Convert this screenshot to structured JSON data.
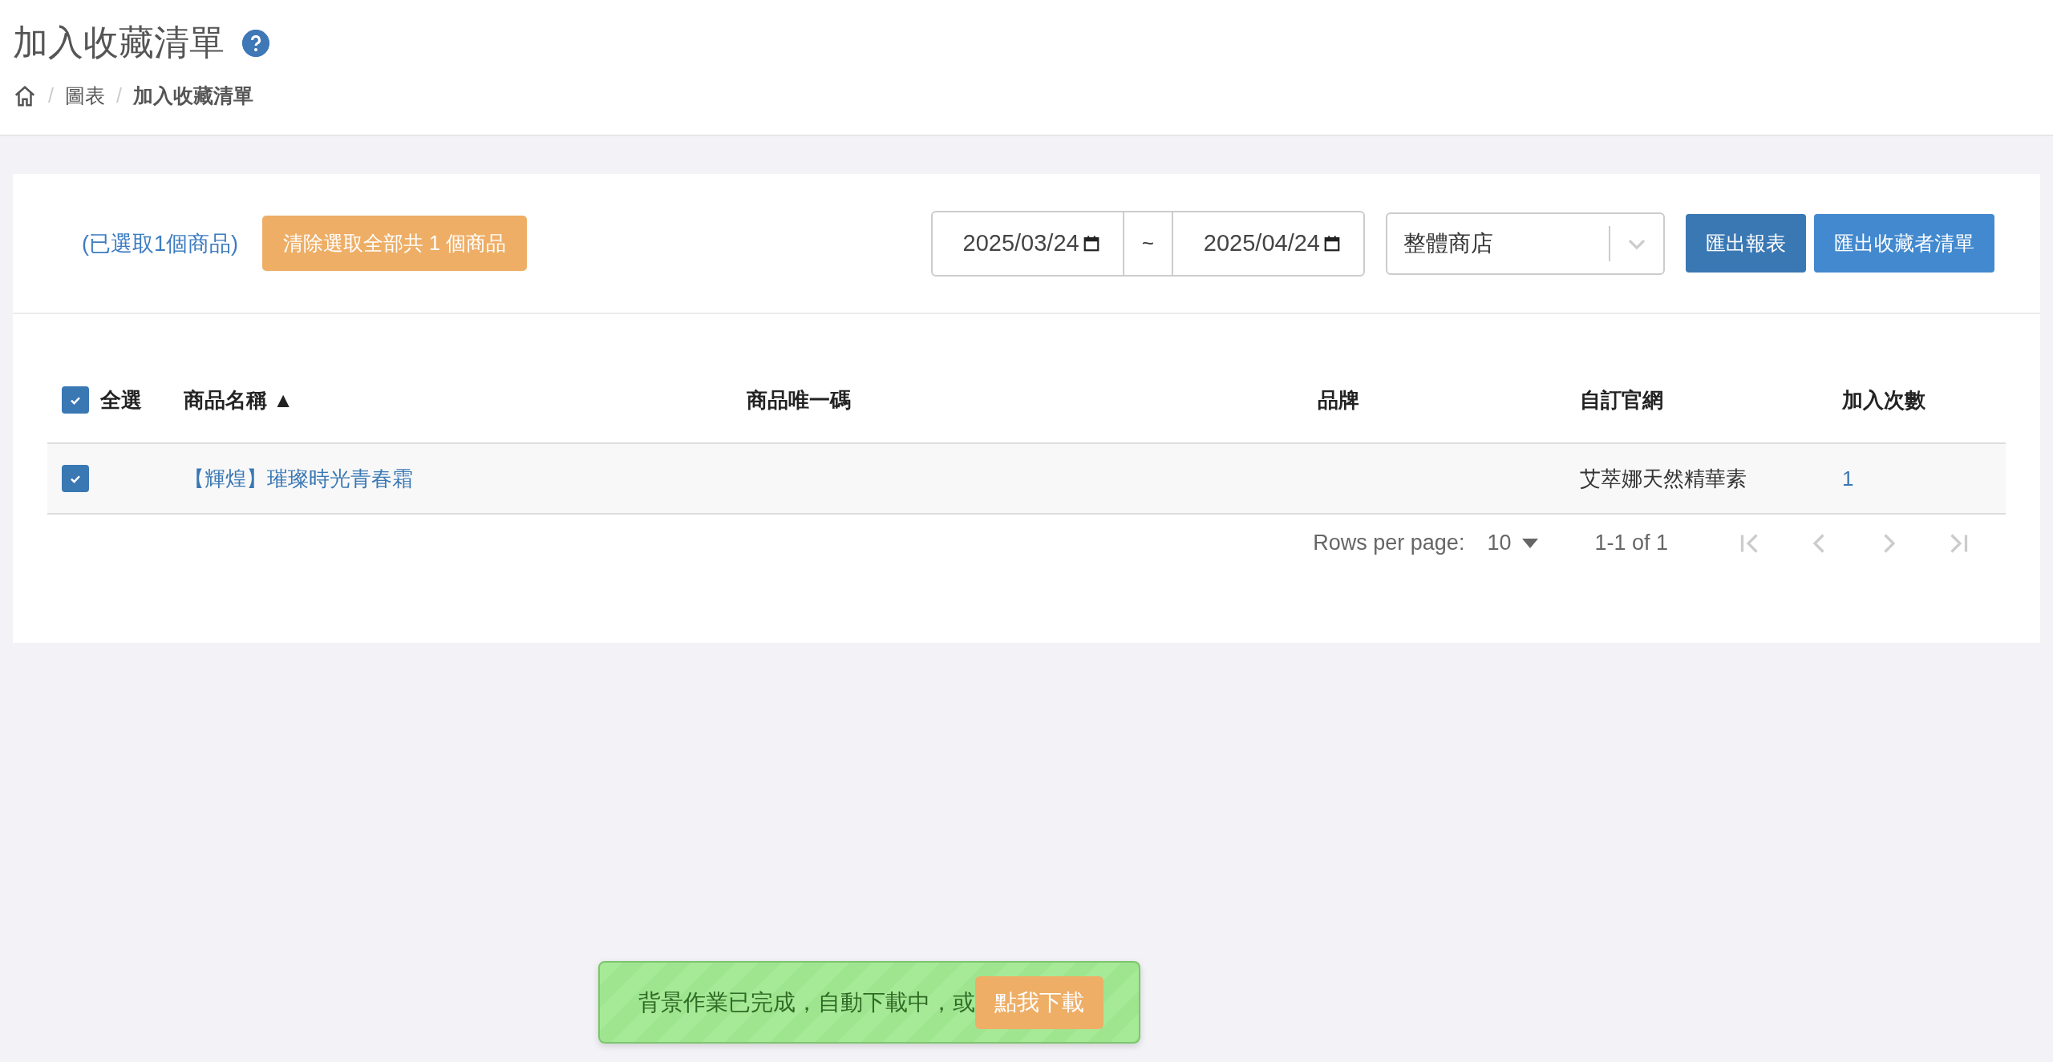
{
  "header": {
    "title": "加入收藏清單",
    "breadcrumb": [
      {
        "kind": "home"
      },
      {
        "kind": "separator",
        "label": "/"
      },
      {
        "kind": "link",
        "label": "圖表"
      },
      {
        "kind": "separator",
        "label": "/"
      },
      {
        "kind": "current",
        "label": "加入收藏清單"
      }
    ]
  },
  "toolbar": {
    "selection_note": "(已選取1個商品)",
    "clear_button": "清除選取全部共 1 個商品",
    "date_from": "2025/03/24",
    "separator": "~",
    "date_to": "2025/04/24",
    "store_select": "整體商店",
    "buttons": [
      {
        "label": "匯出報表",
        "kind": "dark"
      },
      {
        "label": "匯出收藏者清單",
        "kind": "light"
      }
    ]
  },
  "table": {
    "select_all": {
      "label": "全選",
      "checked": true
    },
    "columns": [
      "商品名稱 ▲",
      "商品唯一碼",
      "品牌",
      "自訂官網",
      "加入次數"
    ],
    "rows": [
      {
        "checked": true,
        "cells": [
          "【輝煌】璀璨時光青春霜",
          "",
          "",
          "艾萃娜天然精華素",
          "1"
        ]
      }
    ]
  },
  "pagination": {
    "rows_label": "Rows per page:",
    "rows_value": "10",
    "range": "1-1 of 1",
    "nav": [
      {
        "kind": "first",
        "disabled": true
      },
      {
        "kind": "prev",
        "disabled": true
      },
      {
        "kind": "next",
        "disabled": true
      },
      {
        "kind": "last",
        "disabled": true
      }
    ]
  },
  "toast": {
    "message": "背景作業已完成，自動下載中，或",
    "button": "點我下載"
  }
}
